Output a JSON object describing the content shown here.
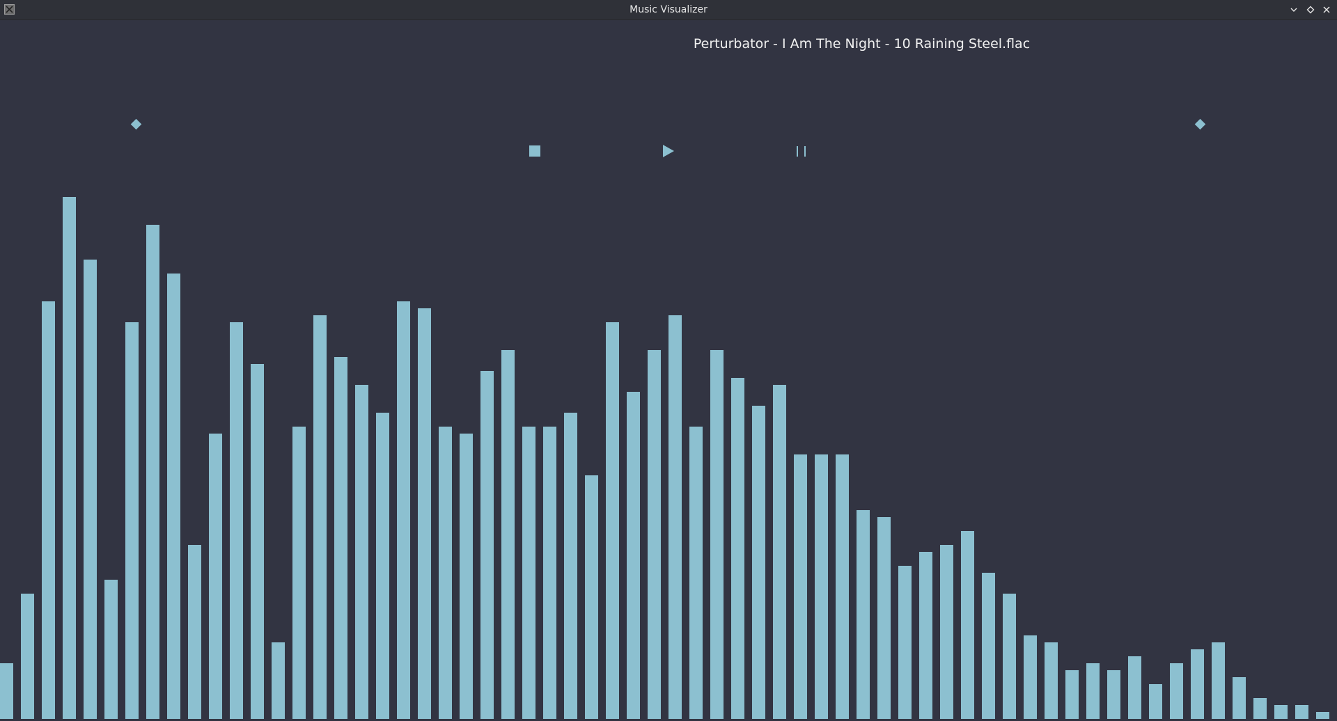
{
  "window": {
    "title": "Music Visualizer"
  },
  "player": {
    "track_name": "Perturbator - I Am The Night - 10 Raining Steel.flac"
  },
  "controls": {
    "stop_icon": "stop-icon",
    "play_icon": "play-icon",
    "pause_icon": "pause-icon",
    "range_marker_icon": "diamond-icon"
  },
  "colors": {
    "background": "#323442",
    "titlebar": "#2f3138",
    "accent": "#8cc0d0",
    "text": "#f0f0f0"
  },
  "chart_data": {
    "type": "bar",
    "max_level": 1.0,
    "values": [
      0.08,
      0.18,
      0.6,
      0.75,
      0.66,
      0.2,
      0.57,
      0.71,
      0.64,
      0.25,
      0.41,
      0.57,
      0.51,
      0.11,
      0.42,
      0.58,
      0.52,
      0.48,
      0.44,
      0.6,
      0.59,
      0.42,
      0.41,
      0.5,
      0.53,
      0.42,
      0.42,
      0.44,
      0.35,
      0.57,
      0.47,
      0.53,
      0.58,
      0.42,
      0.53,
      0.49,
      0.45,
      0.48,
      0.38,
      0.38,
      0.38,
      0.3,
      0.29,
      0.22,
      0.24,
      0.25,
      0.27,
      0.21,
      0.18,
      0.12,
      0.11,
      0.07,
      0.08,
      0.07,
      0.09,
      0.05,
      0.08,
      0.1,
      0.11,
      0.06,
      0.03,
      0.02,
      0.02,
      0.01
    ]
  }
}
